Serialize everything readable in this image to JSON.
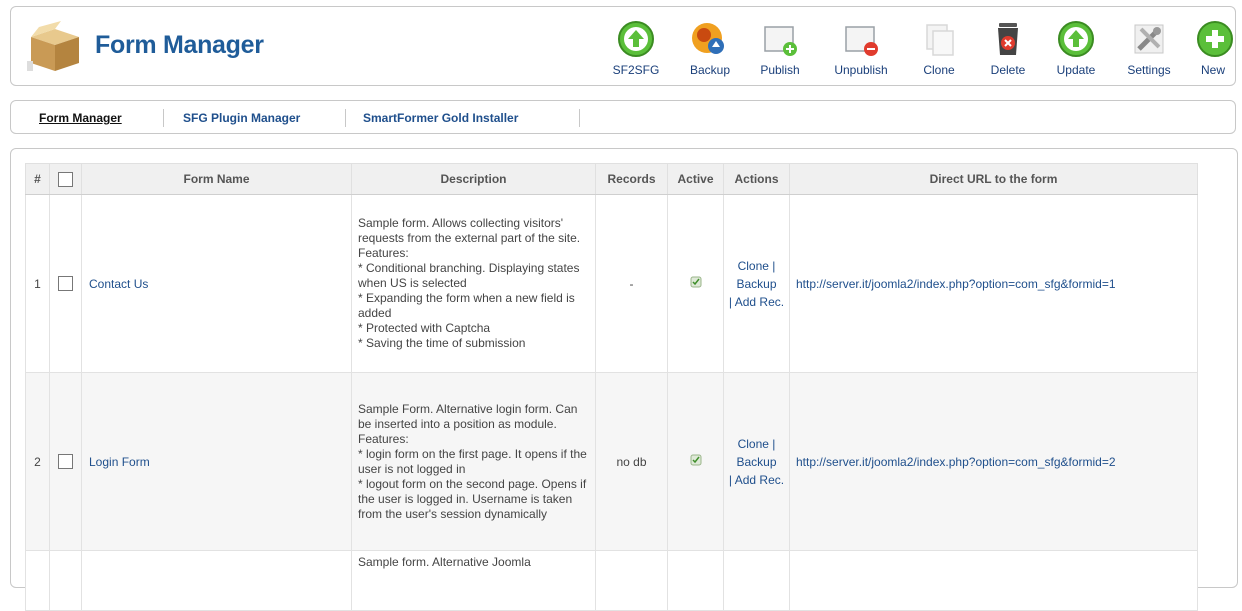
{
  "header": {
    "title": "Form Manager",
    "toolbar": [
      {
        "label": "SF2SFG",
        "icon": "sf2sfg-icon"
      },
      {
        "label": "Backup",
        "icon": "backup-icon"
      },
      {
        "label": "Publish",
        "icon": "publish-icon"
      },
      {
        "label": "Unpublish",
        "icon": "unpublish-icon"
      },
      {
        "label": "Clone",
        "icon": "clone-icon"
      },
      {
        "label": "Delete",
        "icon": "delete-icon"
      },
      {
        "label": "Update",
        "icon": "update-icon"
      },
      {
        "label": "Settings",
        "icon": "settings-icon"
      },
      {
        "label": "New",
        "icon": "new-icon"
      }
    ]
  },
  "submenu": {
    "items": [
      {
        "label": "Form Manager",
        "active": true
      },
      {
        "label": "SFG Plugin Manager",
        "active": false
      },
      {
        "label": "SmartFormer Gold Installer",
        "active": false
      }
    ]
  },
  "table": {
    "columns": [
      "#",
      "",
      "Form Name",
      "Description",
      "Records",
      "Active",
      "Actions",
      "Direct URL to the form"
    ],
    "rows": [
      {
        "num": "1",
        "name": "Contact Us",
        "description": "Sample form. Allows collecting visitors' requests from the external part of the site. Features:\n* Conditional branching. Displaying states when US is selected\n* Expanding the form when a new field is added\n* Protected with Captcha\n* Saving the time of submission",
        "records": "-",
        "actions": {
          "clone": "Clone |",
          "backup": "Backup",
          "add": "| Add Rec."
        },
        "url": "http://server.it/joomla2/index.php?option=com_sfg&formid=1"
      },
      {
        "num": "2",
        "name": "Login Form",
        "description": "Sample Form. Alternative login form. Can be inserted into a position as module. Features:\n* login form on the first page. It opens if the user is not logged in\n* logout form on the second page. Opens if the user is logged in. Username is taken from the user's session dynamically",
        "records": "no db",
        "actions": {
          "clone": "Clone |",
          "backup": "Backup",
          "add": "| Add Rec."
        },
        "url": "http://server.it/joomla2/index.php?option=com_sfg&formid=2"
      },
      {
        "num": "",
        "name": "",
        "description": "Sample form. Alternative Joomla",
        "records": "",
        "actions": {
          "clone": "",
          "backup": "",
          "add": ""
        },
        "url": ""
      }
    ]
  }
}
